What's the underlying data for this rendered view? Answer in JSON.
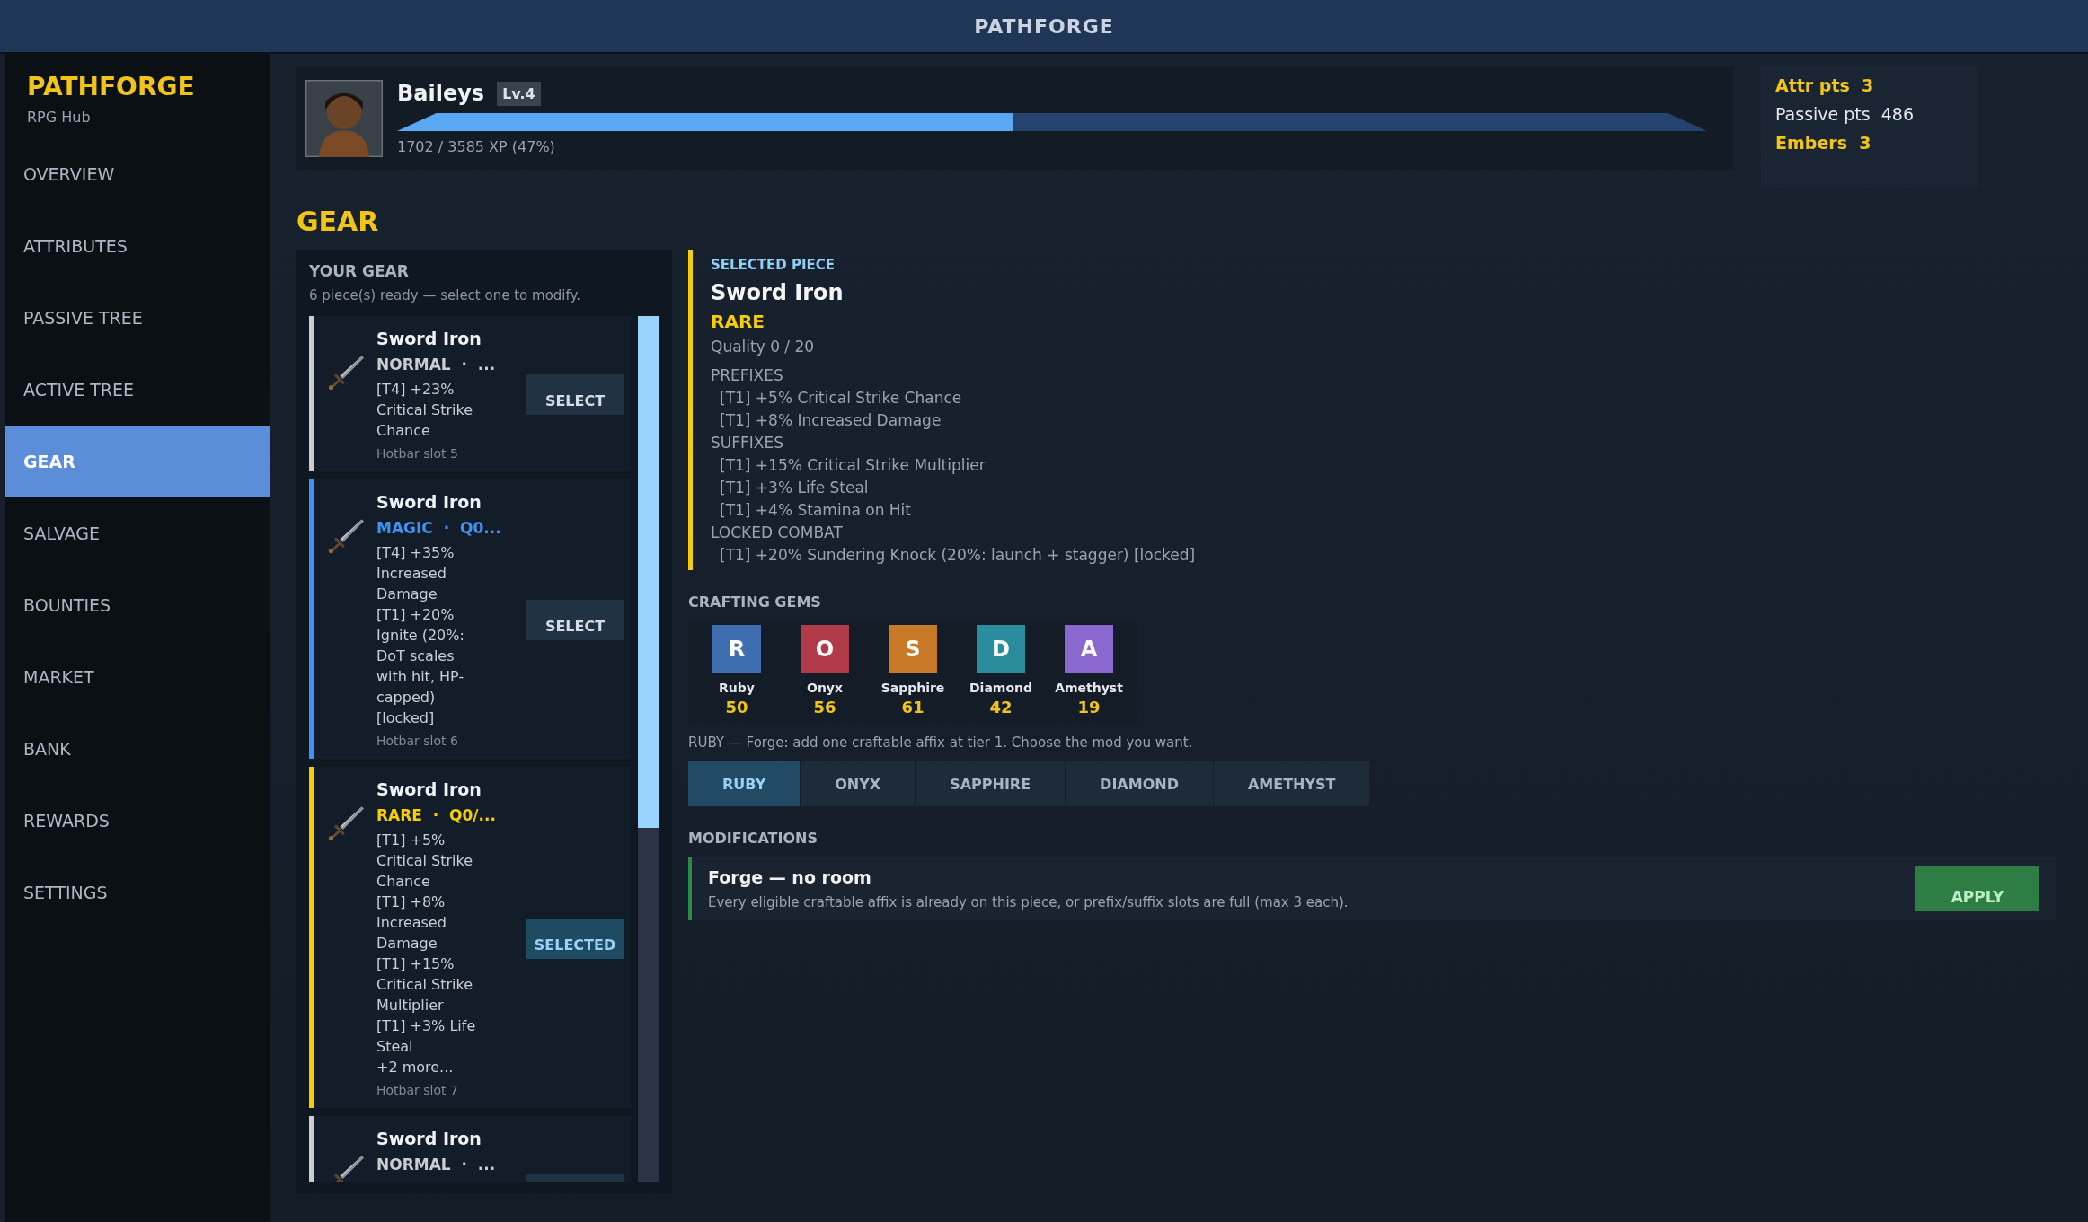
{
  "window": {
    "title": "PATHFORGE"
  },
  "sidebar": {
    "brand": "PATHFORGE",
    "subtitle": "RPG Hub",
    "items": [
      {
        "label": "OVERVIEW",
        "selected": false
      },
      {
        "label": "ATTRIBUTES",
        "selected": false
      },
      {
        "label": "PASSIVE TREE",
        "selected": false
      },
      {
        "label": "ACTIVE TREE",
        "selected": false
      },
      {
        "label": "GEAR",
        "selected": true
      },
      {
        "label": "SALVAGE",
        "selected": false
      },
      {
        "label": "BOUNTIES",
        "selected": false
      },
      {
        "label": "MARKET",
        "selected": false
      },
      {
        "label": "BANK",
        "selected": false
      },
      {
        "label": "REWARDS",
        "selected": false
      },
      {
        "label": "SETTINGS",
        "selected": false
      }
    ]
  },
  "player": {
    "name": "Baileys",
    "level": "Lv.4",
    "xp": "1702 / 3585 XP (47%)",
    "level_progress": {
      "level": 0.47
    }
  },
  "stats": [
    {
      "label": "Attr pts",
      "value": "3",
      "highlight": true
    },
    {
      "label": "Passive pts",
      "value": "486",
      "highlight": false
    },
    {
      "label": "Embers",
      "value": "3",
      "highlight": true
    }
  ],
  "heading": "GEAR",
  "gear_list": {
    "title": "YOUR GEAR",
    "subtitle": "6 piece(s) ready — select one to modify.",
    "items": [
      {
        "name": "Sword Iron",
        "kind": "normal",
        "meta": "NORMAL  ·  ...",
        "mods": [
          "[T4] +23% Critical Strike Chance"
        ],
        "slot": "Hotbar slot 5",
        "button": "SELECT",
        "selected": false
      },
      {
        "name": "Sword Iron",
        "kind": "magic",
        "meta": "MAGIC  ·  Q0...",
        "mods": [
          "[T4] +35% Increased Damage",
          "[T1] +20% Ignite (20%: DoT scales with hit, HP-capped) [locked]"
        ],
        "slot": "Hotbar slot 6",
        "button": "SELECT",
        "selected": false
      },
      {
        "name": "Sword Iron",
        "kind": "rare",
        "meta": "RARE  ·  Q0/...",
        "mods": [
          "[T1] +5% Critical Strike Chance",
          "[T1] +8% Increased Damage",
          "[T1] +15% Critical Strike Multiplier",
          "[T1] +3% Life Steal",
          "+2 more..."
        ],
        "slot": "Hotbar slot 7",
        "button": "SELECTED",
        "selected": true
      },
      {
        "name": "Sword Iron",
        "kind": "normal",
        "meta": "NORMAL  ·  ...",
        "selected": false
      }
    ]
  },
  "selected_piece": {
    "caption": "SELECTED PIECE",
    "name": "Sword Iron",
    "rarity": "RARE",
    "quality": "Quality  0 / 20",
    "sections": [
      {
        "title": "PREFIXES",
        "lines": [
          "[T1] +5% Critical Strike Chance",
          "[T1] +8% Increased Damage"
        ]
      },
      {
        "title": "SUFFIXES",
        "lines": [
          "[T1] +15% Critical Strike Multiplier",
          "[T1] +3% Life Steal",
          "[T1] +4% Stamina on Hit"
        ]
      },
      {
        "title": "LOCKED COMBAT",
        "lines": [
          "[T1] +20% Sundering Knock (20%: launch + stagger) [locked]"
        ]
      }
    ]
  },
  "crafting_gems": {
    "title": "CRAFTING GEMS",
    "gems": [
      {
        "letter": "R",
        "name": "Ruby",
        "count": "50",
        "color": "#3e6eb0"
      },
      {
        "letter": "O",
        "name": "Onyx",
        "count": "56",
        "color": "#b03a48"
      },
      {
        "letter": "S",
        "name": "Sapphire",
        "count": "61",
        "color": "#c87a28"
      },
      {
        "letter": "D",
        "name": "Diamond",
        "count": "42",
        "color": "#2a8c9c"
      },
      {
        "letter": "A",
        "name": "Amethyst",
        "count": "19",
        "color": "#8a68d0"
      }
    ],
    "description": "RUBY — Forge: add one craftable affix at tier 1. Choose the mod you want.",
    "tabs": [
      {
        "label": "RUBY",
        "selected": true
      },
      {
        "label": "ONYX",
        "selected": false
      },
      {
        "label": "SAPPHIRE",
        "selected": false
      },
      {
        "label": "DIAMOND",
        "selected": false
      },
      {
        "label": "AMETHYST",
        "selected": false
      }
    ]
  },
  "modifications": {
    "title": "MODIFICATIONS",
    "items": [
      {
        "name": "Forge — no room",
        "description": "Every eligible craftable affix is already on this piece, or prefix/suffix slots are full (max 3 each).",
        "button": "APPLY"
      }
    ]
  }
}
